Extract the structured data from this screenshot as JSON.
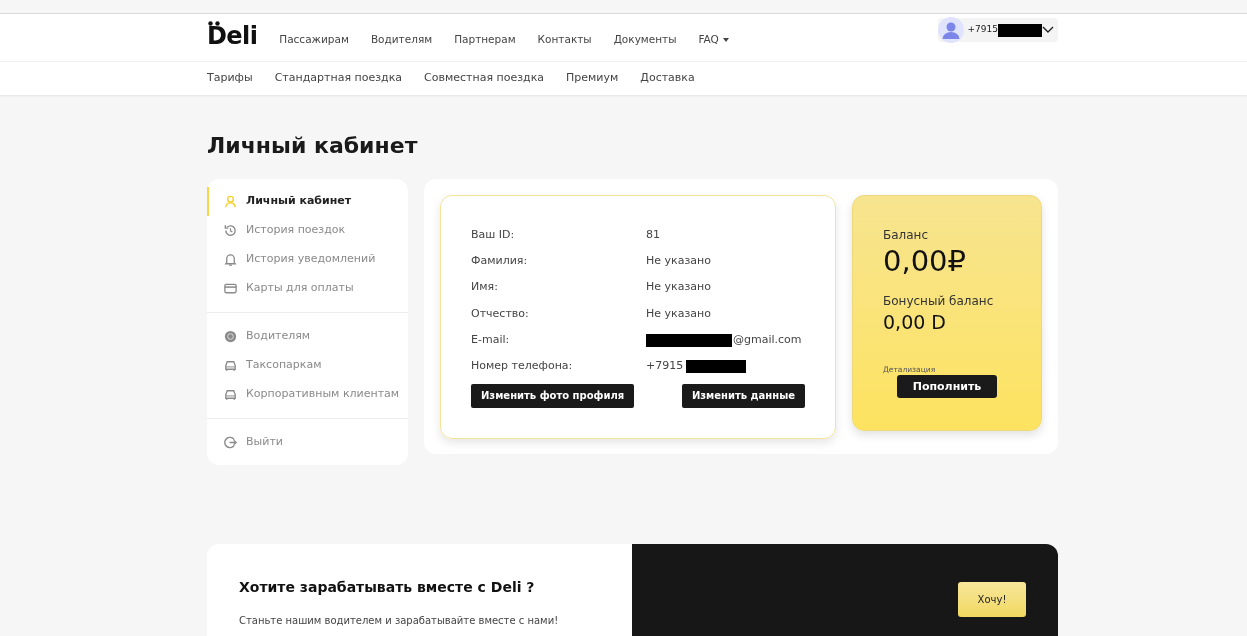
{
  "header": {
    "logo": "Deli",
    "nav": [
      {
        "label": "Пассажирам",
        "dropdown": false
      },
      {
        "label": "Водителям",
        "dropdown": false
      },
      {
        "label": "Партнерам",
        "dropdown": false
      },
      {
        "label": "Контакты",
        "dropdown": false
      },
      {
        "label": "Документы",
        "dropdown": false
      },
      {
        "label": "FAQ",
        "dropdown": true
      }
    ],
    "account": {
      "phone": "+7915",
      "redacted": true
    }
  },
  "subnav": [
    "Тарифы",
    "Стандартная поездка",
    "Совместная поездка",
    "Премиум",
    "Доставка"
  ],
  "page_title": "Личный кабинет",
  "sidebar": {
    "groups": [
      [
        {
          "label": "Личный кабинет",
          "selected": true
        },
        {
          "label": "История поездок",
          "selected": false
        },
        {
          "label": "История уведомлений",
          "selected": false
        },
        {
          "label": "Карты для оплаты",
          "selected": false
        }
      ],
      [
        {
          "label": "Водителям",
          "selected": false
        },
        {
          "label": "Таксопаркам",
          "selected": false
        },
        {
          "label": "Корпоративным клиентам",
          "selected": false
        }
      ],
      [
        {
          "label": "Выйти",
          "selected": false
        }
      ]
    ]
  },
  "profile": {
    "fields": [
      {
        "label": "Ваш ID:",
        "value": "81"
      },
      {
        "label": "Фамилия:",
        "value": "Не указано"
      },
      {
        "label": "Имя:",
        "value": "Не указано"
      },
      {
        "label": "Отчество:",
        "value": "Не указано"
      },
      {
        "label": "E-mail:",
        "value": "@gmail.com",
        "redacted_prefix": true
      },
      {
        "label": "Номер телефона:",
        "value": "+7915",
        "redacted_suffix": true
      }
    ],
    "buttons": [
      "Изменить фото профиля",
      "Изменить данные"
    ]
  },
  "balance": {
    "label": "Баланс",
    "amount": "0,00₽",
    "bonus_label": "Бонусный баланс",
    "bonus_amount": "0,00 D",
    "details_link": "Детализация",
    "button": "Пополнить"
  },
  "banner": {
    "title": "Хотите зарабатывать вместе с Deli ?",
    "text": "Станьте нашим водителем и зарабатывайте вместе с нами!",
    "button": "Хочу!"
  }
}
